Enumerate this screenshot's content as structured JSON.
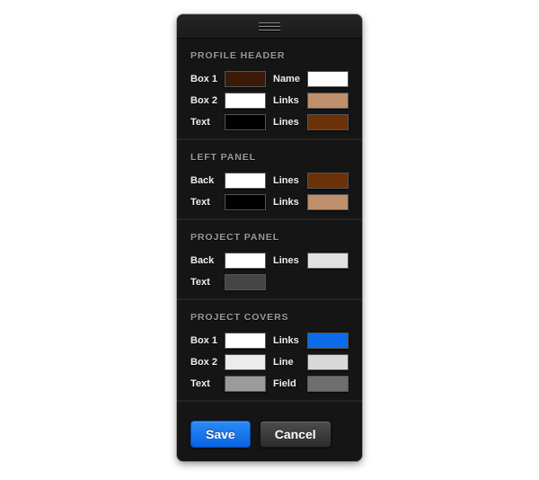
{
  "dialog": {
    "drag_handle": "drag-handle-icon",
    "sections": [
      {
        "title": "PROFILE HEADER",
        "rows": [
          {
            "left": {
              "label": "Box 1",
              "color": "#3a1a07"
            },
            "right": {
              "label": "Name",
              "color": "#ffffff"
            }
          },
          {
            "left": {
              "label": "Box 2",
              "color": "#ffffff"
            },
            "right": {
              "label": "Links",
              "color": "#c08f6b"
            }
          },
          {
            "left": {
              "label": "Text",
              "color": "#000000"
            },
            "right": {
              "label": "Lines",
              "color": "#6b3207"
            }
          }
        ]
      },
      {
        "title": "LEFT PANEL",
        "rows": [
          {
            "left": {
              "label": "Back",
              "color": "#ffffff"
            },
            "right": {
              "label": "Lines",
              "color": "#6b3207"
            }
          },
          {
            "left": {
              "label": "Text",
              "color": "#000000"
            },
            "right": {
              "label": "Links",
              "color": "#c08f6b"
            }
          }
        ]
      },
      {
        "title": "PROJECT PANEL",
        "rows": [
          {
            "left": {
              "label": "Back",
              "color": "#ffffff"
            },
            "right": {
              "label": "Lines",
              "color": "#e2e2e2"
            }
          },
          {
            "left": {
              "label": "Text",
              "color": "#454545"
            },
            "right": null
          }
        ]
      },
      {
        "title": "PROJECT COVERS",
        "rows": [
          {
            "left": {
              "label": "Box 1",
              "color": "#ffffff"
            },
            "right": {
              "label": "Links",
              "color": "#0d6ae8"
            }
          },
          {
            "left": {
              "label": "Box 2",
              "color": "#ececec"
            },
            "right": {
              "label": "Line",
              "color": "#d8d8d8"
            }
          },
          {
            "left": {
              "label": "Text",
              "color": "#9b9b9b"
            },
            "right": {
              "label": "Field",
              "color": "#6e6e6e"
            }
          }
        ]
      }
    ],
    "footer": {
      "save_label": "Save",
      "cancel_label": "Cancel"
    }
  }
}
